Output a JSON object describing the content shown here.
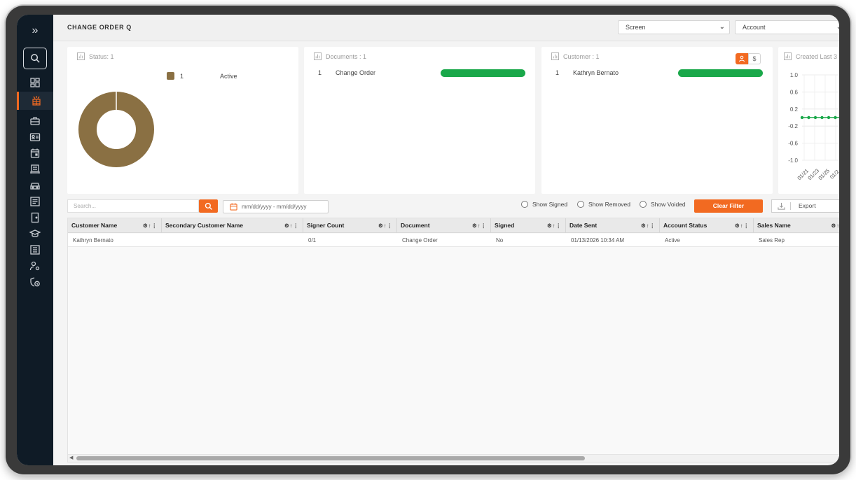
{
  "header": {
    "title": "CHANGE ORDER Q",
    "screen_select": "Screen",
    "account_select": "Account"
  },
  "sidebar": {
    "items": [
      {
        "icon": "dashboard-icon"
      },
      {
        "icon": "change-order-icon",
        "active": true
      },
      {
        "icon": "briefcase-icon"
      },
      {
        "icon": "contact-card-icon"
      },
      {
        "icon": "calendar-icon"
      },
      {
        "icon": "document-stack-icon"
      },
      {
        "icon": "car-icon"
      },
      {
        "icon": "list-doc-icon"
      },
      {
        "icon": "door-icon"
      },
      {
        "icon": "graduation-cap-icon"
      },
      {
        "icon": "report-icon"
      },
      {
        "icon": "user-settings-icon"
      },
      {
        "icon": "security-clock-icon"
      }
    ]
  },
  "cards": {
    "status": {
      "title": "Status: 1",
      "legend_count": "1",
      "legend_label": "Active",
      "color": "#8a7043"
    },
    "documents": {
      "title": "Documents : 1",
      "rows": [
        {
          "index": "1",
          "name": "Change Order"
        }
      ]
    },
    "customer": {
      "title": "Customer : 1",
      "rows": [
        {
          "index": "1",
          "name": "Kathryn Bernato"
        }
      ],
      "dollar_label": "$"
    },
    "created": {
      "title": "Created Last 3"
    }
  },
  "chart_data": [
    {
      "type": "pie",
      "categories": [
        "Active"
      ],
      "values": [
        1
      ],
      "colors": [
        "#8a7043"
      ]
    },
    {
      "type": "line",
      "yticks": [
        "1.0",
        "0.6",
        "0.2",
        "-0.2",
        "-0.6",
        "-1.0"
      ],
      "xticks": [
        "01/21",
        "01/23",
        "01/25",
        "01/2"
      ],
      "ylim": [
        -1.0,
        1.0
      ],
      "series": [
        {
          "values": [
            0,
            0,
            0,
            0,
            0,
            0,
            0
          ],
          "color": "#1aa84a"
        }
      ]
    }
  ],
  "filters": {
    "search_placeholder": "Search...",
    "date_placeholder": "mm/dd/yyyy - mm/dd/yyyy",
    "show_signed": "Show Signed",
    "show_removed": "Show Removed",
    "show_voided": "Show Voided",
    "clear_filter": "Clear Filter",
    "export": "Export"
  },
  "table": {
    "columns": [
      "Customer Name",
      "Secondary Customer Name",
      "Signer Count",
      "Document",
      "Signed",
      "Date Sent",
      "Account Status",
      "Sales Name"
    ],
    "rows": [
      [
        "Kathryn Bernato",
        "",
        "0/1",
        "Change Order",
        "No",
        "01/13/2026 10:34 AM",
        "Active",
        "Sales Rep"
      ]
    ]
  },
  "colors": {
    "accent": "#f26a21",
    "sidebar": "#0f1b26",
    "bar_green": "#1aa84a"
  }
}
